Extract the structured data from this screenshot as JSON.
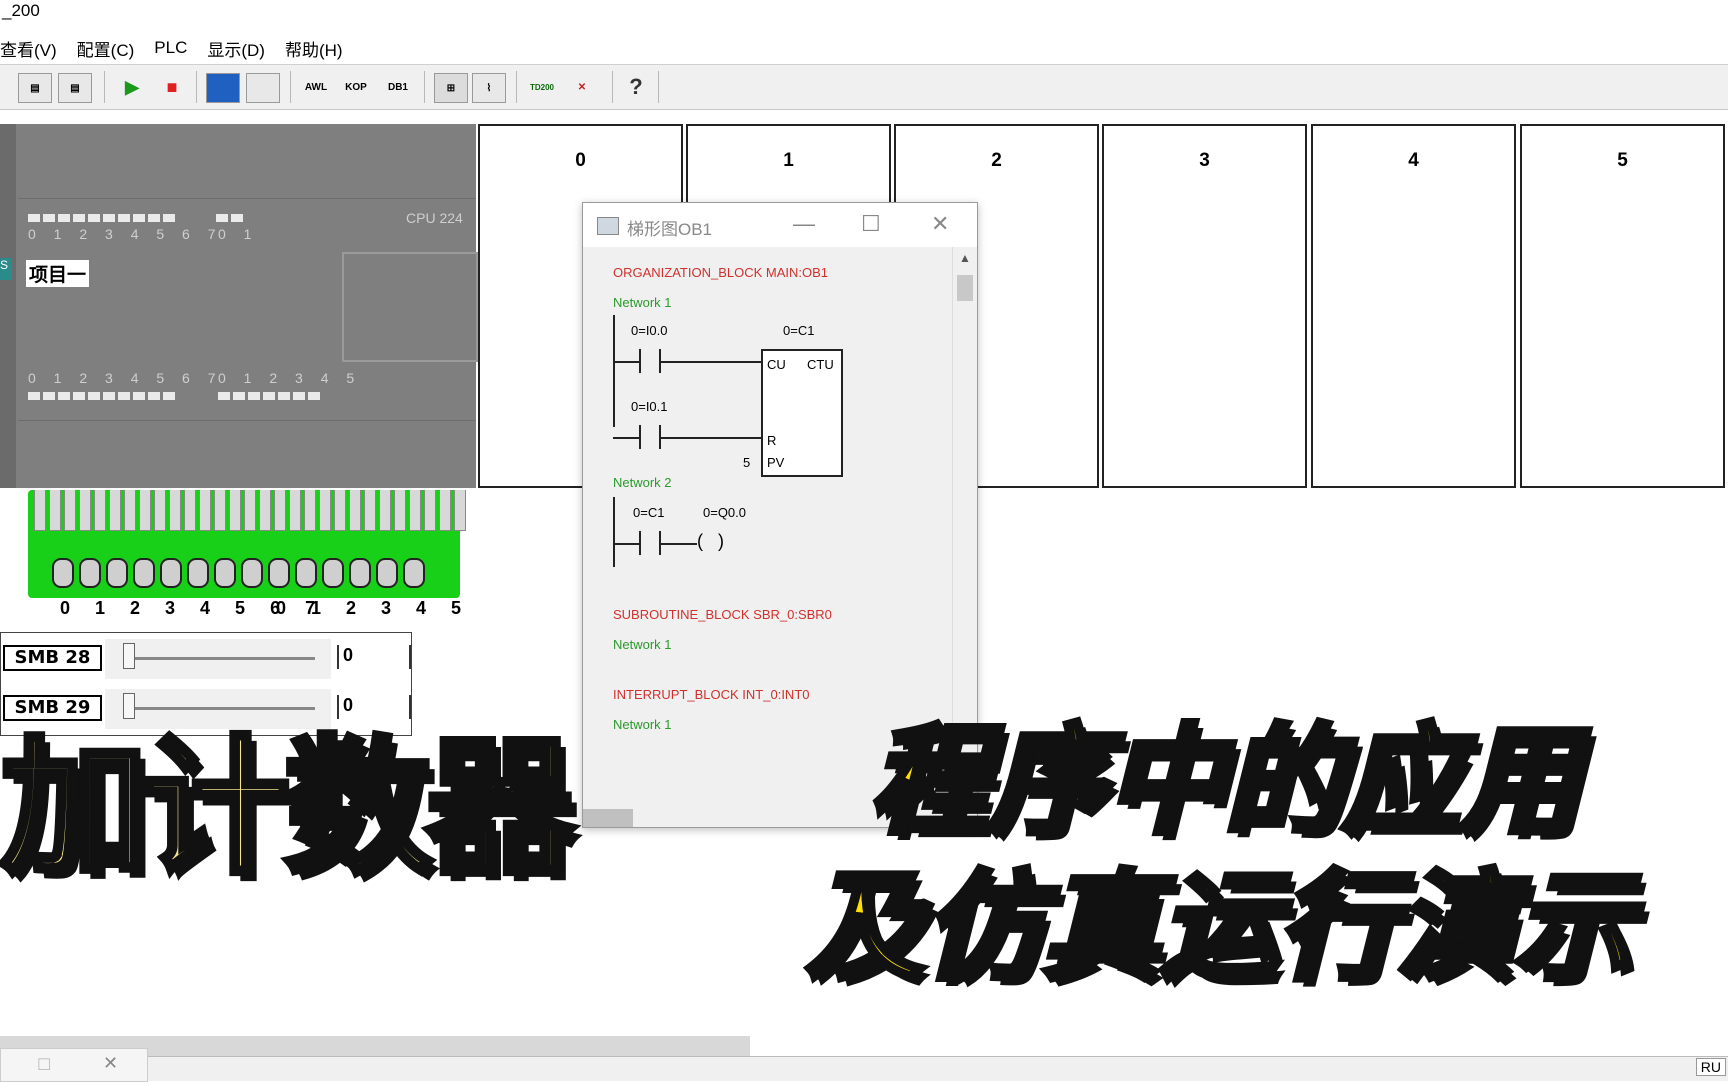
{
  "window": {
    "title": "_200"
  },
  "menu": [
    "查看(V)",
    "配置(C)",
    "PLC",
    "显示(D)",
    "帮助(H)"
  ],
  "toolbar": {
    "awl": "AWL",
    "kop": "KOP",
    "db1": "DB1",
    "td200": "TD200",
    "help": "?"
  },
  "plc": {
    "cpu_label": "CPU 224",
    "project_label": "项目一",
    "side_tag": "S",
    "input_top_nums": "0 1 2 3 4 5 6 7",
    "input_top_nums2": "0 1",
    "output_nums": "0 1 2 3 4 5 6 7",
    "output_nums2": "0 1 2 3 4 5"
  },
  "terminal": {
    "nums": "0 1 2 3 4 5 6 7",
    "nums2": "0 1 2 3 4 5"
  },
  "smb": [
    {
      "label": "SMB 28",
      "value": "0"
    },
    {
      "label": "SMB 29",
      "value": "0"
    }
  ],
  "slots": [
    "0",
    "1",
    "2",
    "3",
    "4",
    "5"
  ],
  "ladder_window": {
    "title": "梯形图OB1",
    "org_block": "ORGANIZATION_BLOCK MAIN:OB1",
    "network1": "Network 1",
    "contact1": "0=I0.0",
    "counter": "0=C1",
    "contact2": "0=I0.1",
    "cu": "CU",
    "ctu": "CTU",
    "r": "R",
    "pv_value": "5",
    "pv": "PV",
    "network2": "Network 2",
    "contact3": "0=C1",
    "coil": "0=Q0.0",
    "sub_block": "SUBROUTINE_BLOCK SBR_0:SBR0",
    "sub_network": "Network 1",
    "int_block": "INTERRUPT_BLOCK INT_0:INT0",
    "int_network": "Network 1"
  },
  "overlay": {
    "left": "加计数器",
    "right_line1": "程序中的应用",
    "right_line2": "及仿真运行演示"
  },
  "status": {
    "right": "RU"
  }
}
